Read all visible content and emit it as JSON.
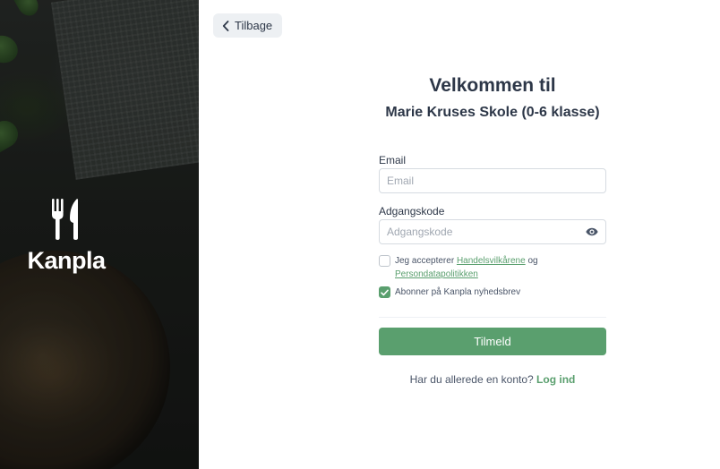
{
  "brand": {
    "name": "Kanpla",
    "icon": "cutlery-icon"
  },
  "nav": {
    "back_label": "Tilbage",
    "back_icon": "chevron-left-icon"
  },
  "header": {
    "title": "Velkommen til",
    "subtitle": "Marie Kruses Skole (0-6 klasse)"
  },
  "form": {
    "email": {
      "label": "Email",
      "placeholder": "Email",
      "value": ""
    },
    "password": {
      "label": "Adgangskode",
      "placeholder": "Adgangskode",
      "value": "",
      "toggle_icon": "eye-icon"
    },
    "terms": {
      "checked": false,
      "prefix": "Jeg accepterer",
      "link1": "Handelsvilkårene",
      "middle": "og",
      "link2": "Persondatapolitikken"
    },
    "newsletter": {
      "checked": true,
      "label": "Abonner på Kanpla nyhedsbrev"
    },
    "submit_label": "Tilmeld"
  },
  "footer": {
    "prompt": "Har du allerede en konto?",
    "login_label": "Log ind"
  },
  "colors": {
    "accent": "#5a9f6e",
    "text": "#2d3748"
  }
}
